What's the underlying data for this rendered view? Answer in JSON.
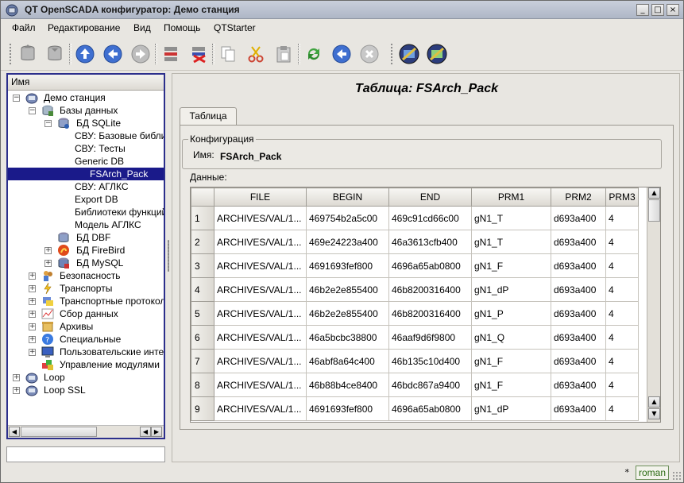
{
  "window": {
    "title": "QT OpenSCADA конфигуратор: Демо станция",
    "controls": [
      "_",
      "□",
      "×"
    ]
  },
  "menu": {
    "items": [
      "Файл",
      "Редактирование",
      "Вид",
      "Помощь",
      "QTStarter"
    ]
  },
  "tree": {
    "header": "Имя",
    "items": [
      {
        "label": "Демо станция",
        "icon": "station-icon"
      },
      {
        "label": "Базы данных",
        "icon": "databases-icon"
      },
      {
        "label": "БД SQLite",
        "icon": "db-icon"
      },
      {
        "label": "СВУ: Базовые библиотеки",
        "icon": ""
      },
      {
        "label": "СВУ: Тесты",
        "icon": ""
      },
      {
        "label": "Generic DB",
        "icon": ""
      },
      {
        "label": "FSArch_Pack",
        "icon": ""
      },
      {
        "label": "СВУ: АГЛКС",
        "icon": ""
      },
      {
        "label": "Export DB",
        "icon": ""
      },
      {
        "label": "Библиотеки функций",
        "icon": ""
      },
      {
        "label": "Модель АГЛКС",
        "icon": ""
      },
      {
        "label": "БД DBF",
        "icon": "db-icon"
      },
      {
        "label": "БД FireBird",
        "icon": "firebird-icon"
      },
      {
        "label": "БД MySQL",
        "icon": "mysql-icon"
      },
      {
        "label": "Безопасность",
        "icon": "security-icon"
      },
      {
        "label": "Транспорты",
        "icon": "transport-icon"
      },
      {
        "label": "Транспортные протоколы",
        "icon": "protocol-icon"
      },
      {
        "label": "Сбор данных",
        "icon": "daq-icon"
      },
      {
        "label": "Архивы",
        "icon": "archive-icon"
      },
      {
        "label": "Специальные",
        "icon": "special-icon"
      },
      {
        "label": "Пользовательские интерфейсы",
        "icon": "ui-icon"
      },
      {
        "label": "Управление модулями",
        "icon": "modules-icon"
      },
      {
        "label": "Loop",
        "icon": "station-icon"
      },
      {
        "label": "Loop SSL",
        "icon": "station-icon"
      }
    ]
  },
  "page": {
    "title": "Таблица: FSArch_Pack",
    "tab": "Таблица",
    "group_label": "Конфигурация",
    "name_label": "Имя:",
    "name_value": "FSArch_Pack",
    "data_label": "Данные:"
  },
  "table": {
    "columns": [
      "FILE",
      "BEGIN",
      "END",
      "PRM1",
      "PRM2",
      "PRM3"
    ],
    "rows": [
      {
        "n": "1",
        "cells": [
          "ARCHIVES/VAL/1...",
          "469754b2a5c00",
          "469c91cd66c00",
          "gN1_T",
          "d693a400",
          "4"
        ]
      },
      {
        "n": "2",
        "cells": [
          "ARCHIVES/VAL/1...",
          "469e24223a400",
          "46a3613cfb400",
          "gN1_T",
          "d693a400",
          "4"
        ]
      },
      {
        "n": "3",
        "cells": [
          "ARCHIVES/VAL/1...",
          "4691693fef800",
          "4696a65ab0800",
          "gN1_F",
          "d693a400",
          "4"
        ]
      },
      {
        "n": "4",
        "cells": [
          "ARCHIVES/VAL/1...",
          "46b2e2e855400",
          "46b8200316400",
          "gN1_dP",
          "d693a400",
          "4"
        ]
      },
      {
        "n": "5",
        "cells": [
          "ARCHIVES/VAL/1...",
          "46b2e2e855400",
          "46b8200316400",
          "gN1_P",
          "d693a400",
          "4"
        ]
      },
      {
        "n": "6",
        "cells": [
          "ARCHIVES/VAL/1...",
          "46a5bcbc38800",
          "46aaf9d6f9800",
          "gN1_Q",
          "d693a400",
          "4"
        ]
      },
      {
        "n": "7",
        "cells": [
          "ARCHIVES/VAL/1...",
          "46abf8a64c400",
          "46b135c10d400",
          "gN1_F",
          "d693a400",
          "4"
        ]
      },
      {
        "n": "8",
        "cells": [
          "ARCHIVES/VAL/1...",
          "46b88b4ce8400",
          "46bdc867a9400",
          "gN1_F",
          "d693a400",
          "4"
        ]
      },
      {
        "n": "9",
        "cells": [
          "ARCHIVES/VAL/1...",
          "4691693fef800",
          "4696a65ab0800",
          "gN1_dP",
          "d693a400",
          "4"
        ]
      }
    ]
  },
  "status": {
    "modified_mark": "*",
    "language": "roman"
  }
}
